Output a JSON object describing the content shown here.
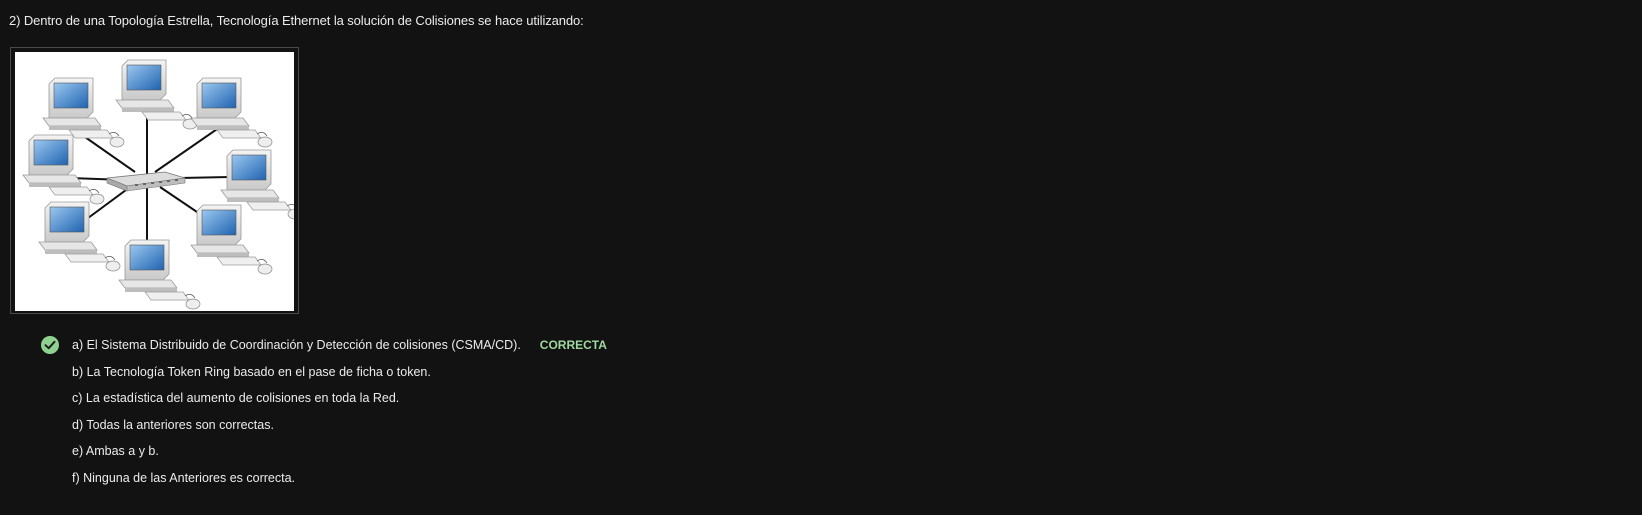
{
  "question": {
    "text": "2) Dentro de una Topología Estrella, Tecnología Ethernet la solución de Colisiones se hace utilizando:"
  },
  "figure": {
    "icon": "star-topology-network-diagram"
  },
  "options": [
    {
      "label": "a) El Sistema Distribuido de Coordinación y Detección de colisiones (CSMA/CD).",
      "correct": true,
      "badge": "CORRECTA"
    },
    {
      "label": "b) La Tecnología Token Ring basado en el pase de ficha o token."
    },
    {
      "label": "c) La estadística del aumento de colisiones en toda la Red."
    },
    {
      "label": "d) Todas la anteriores son correctas."
    },
    {
      "label": "e) Ambas a y b."
    },
    {
      "label": "f) Ninguna de las Anteriores es correcta."
    }
  ],
  "colors": {
    "background": "#121212",
    "correct_green": "#9fd89f",
    "text": "#ececec"
  }
}
